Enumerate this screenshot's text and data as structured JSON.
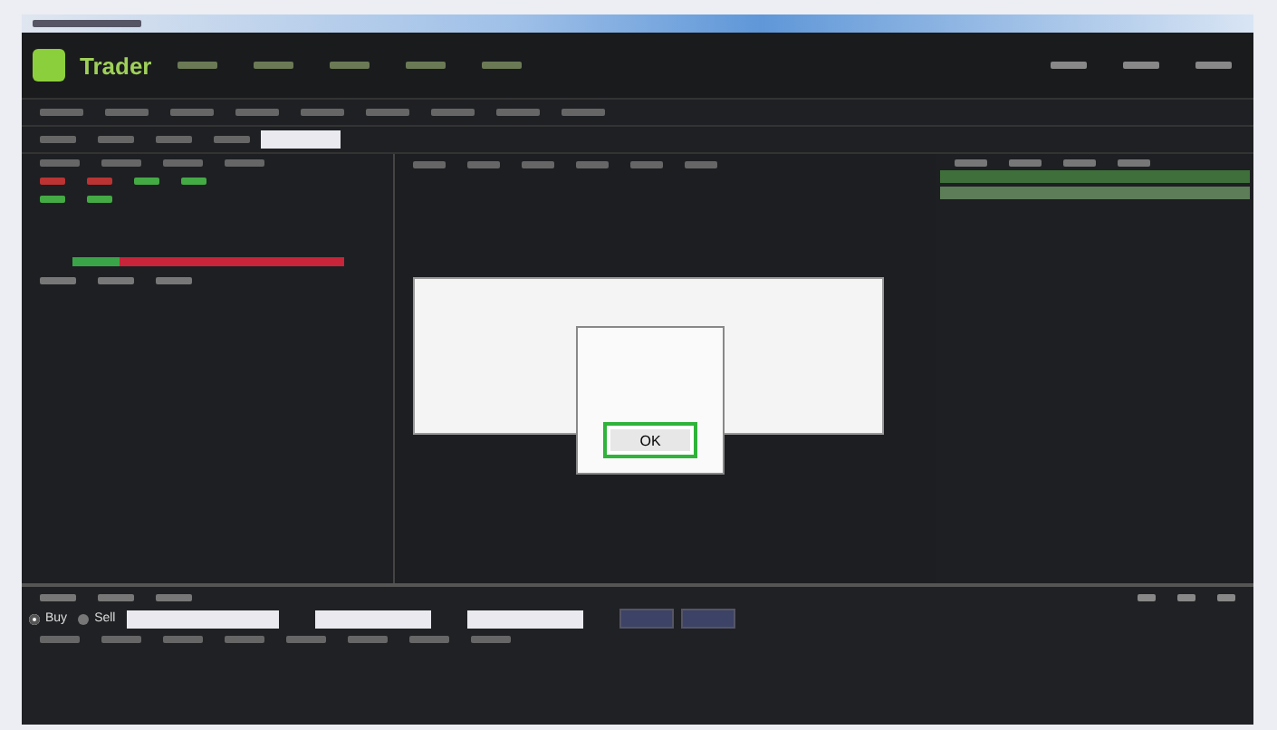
{
  "header": {
    "logo_text": "Trader"
  },
  "depth_meter": {
    "level": 0.17
  },
  "dialog": {
    "message_box": {
      "ok_button": {
        "label": "OK",
        "highlighted": true
      }
    }
  },
  "order_side": [
    {
      "label": "Buy",
      "selected": true
    },
    {
      "label": "Sell",
      "selected": false
    }
  ]
}
